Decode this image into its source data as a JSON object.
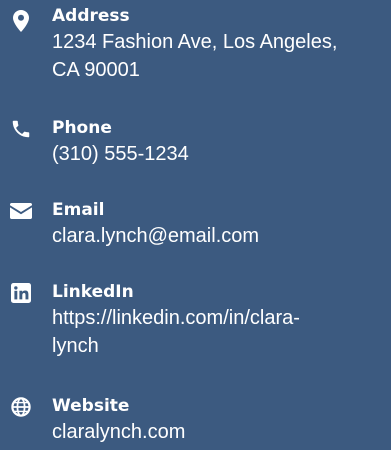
{
  "contacts": {
    "address": {
      "icon": "map-marker-icon",
      "label": "Address",
      "value_lines": [
        "1234 Fashion Ave, Los Angeles,",
        "CA 90001"
      ]
    },
    "phone": {
      "icon": "phone-icon",
      "label": "Phone",
      "value": "(310) 555-1234"
    },
    "email": {
      "icon": "envelope-icon",
      "label": "Email",
      "value": "clara.lynch@email.com"
    },
    "linkedin": {
      "icon": "linkedin-icon",
      "label": "LinkedIn",
      "value_lines": [
        "https://linkedin.com/in/clara-",
        "lynch"
      ]
    },
    "website": {
      "icon": "globe-icon",
      "label": "Website",
      "value": "claralynch.com"
    }
  },
  "colors": {
    "background": "#3c5a80",
    "text": "#ffffff"
  }
}
